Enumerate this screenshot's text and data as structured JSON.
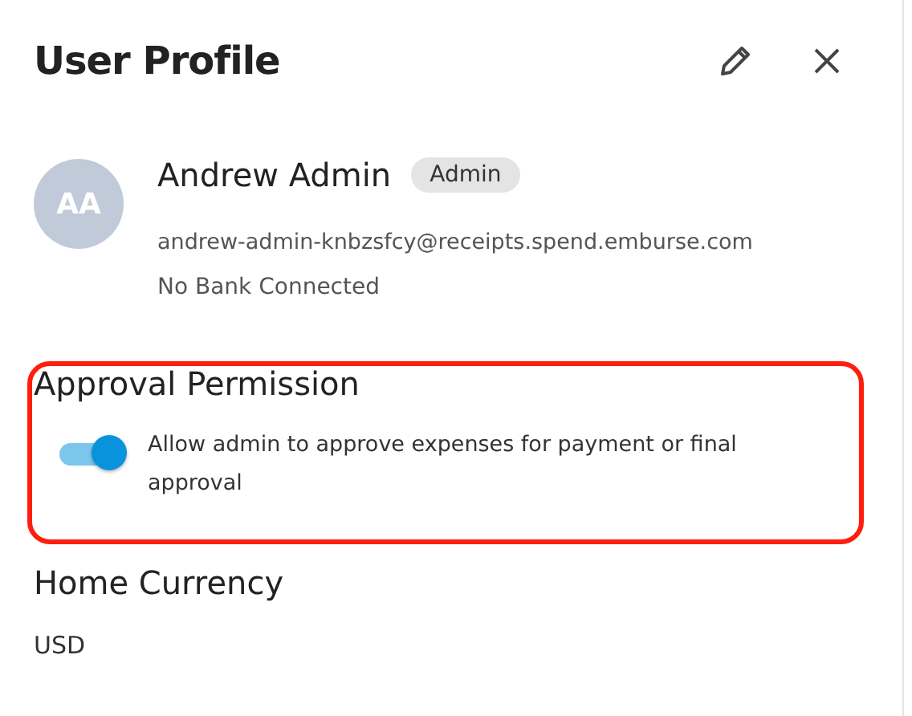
{
  "header": {
    "title": "User Profile"
  },
  "profile": {
    "initials": "AA",
    "name": "Andrew Admin",
    "role_badge": "Admin",
    "email": "andrew-admin-knbzsfcy@receipts.spend.emburse.com",
    "bank_status": "No Bank Connected"
  },
  "approval_permission": {
    "title": "Approval Permission",
    "highlighted": true,
    "toggle": {
      "on": true,
      "label": "Allow admin to approve expenses for payment or final approval"
    }
  },
  "home_currency": {
    "title": "Home Currency",
    "value": "USD"
  }
}
